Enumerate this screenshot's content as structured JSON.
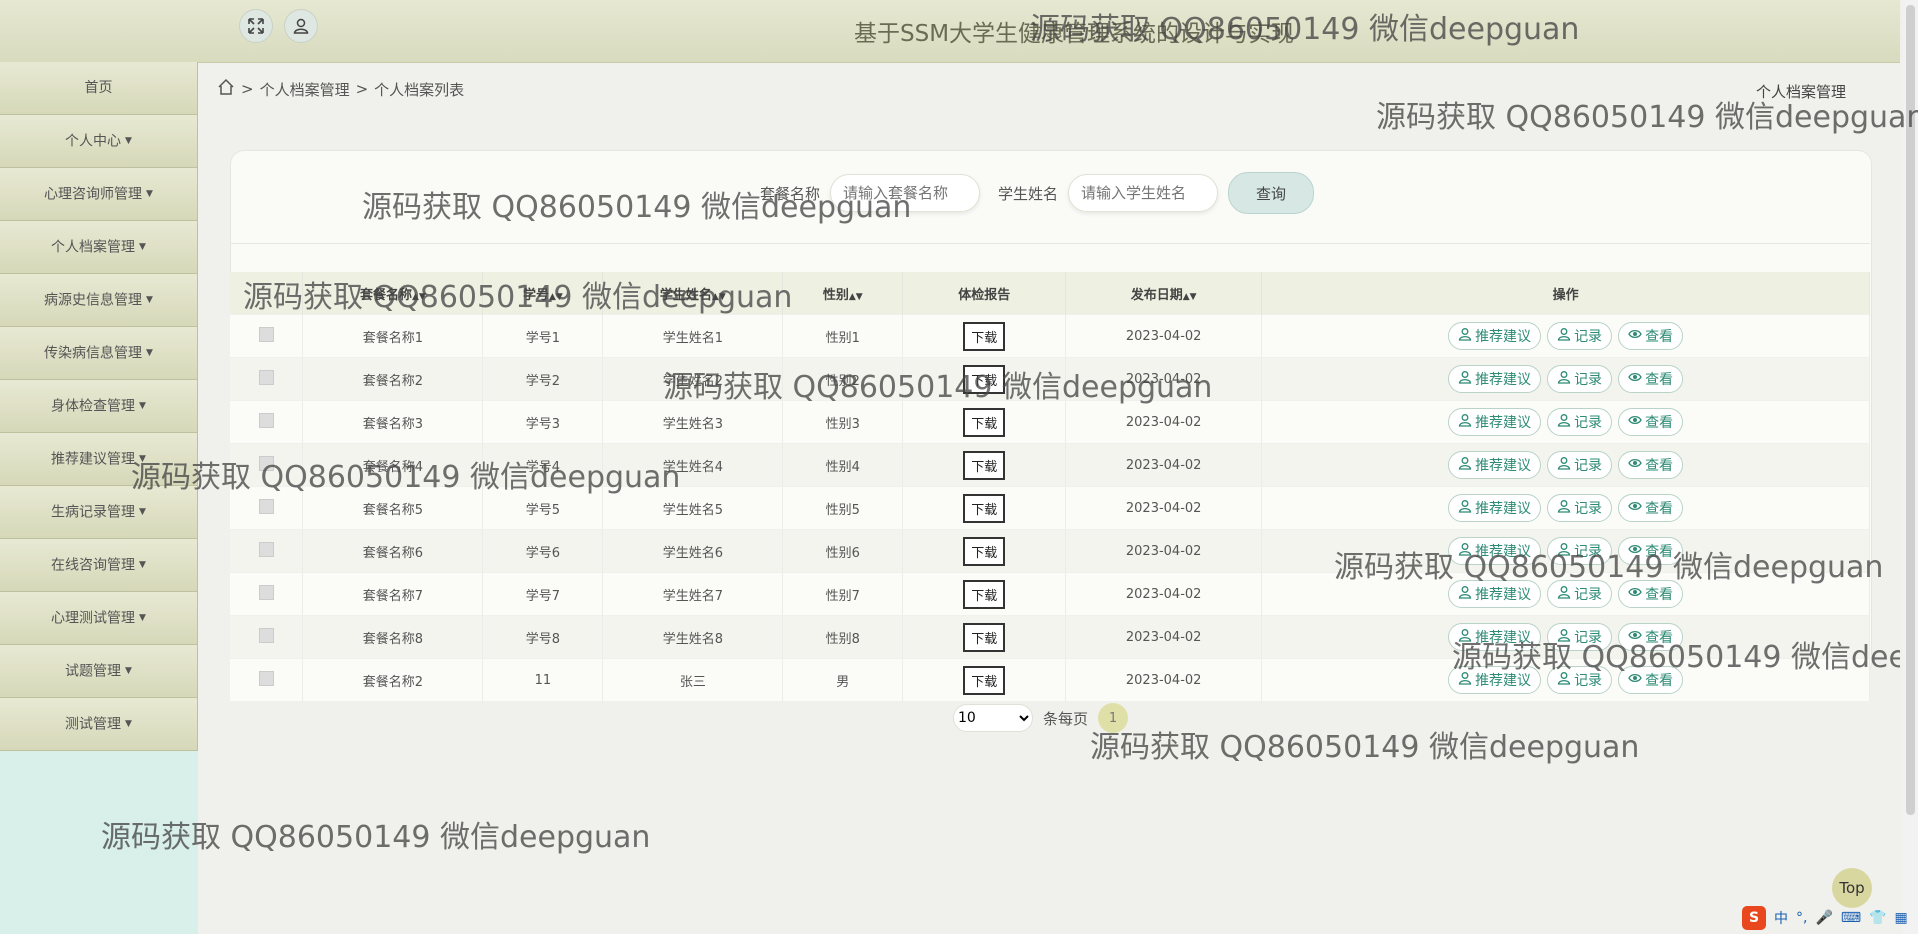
{
  "header": {
    "title": "基于SSM大学生健康管理系统的设计与实现"
  },
  "sidebar": {
    "items": [
      {
        "label": "首页",
        "caret": false
      },
      {
        "label": "个人中心",
        "caret": true
      },
      {
        "label": "心理咨询师管理",
        "caret": true
      },
      {
        "label": "个人档案管理",
        "caret": true
      },
      {
        "label": "病源史信息管理",
        "caret": true
      },
      {
        "label": "传染病信息管理",
        "caret": true
      },
      {
        "label": "身体检查管理",
        "caret": true
      },
      {
        "label": "推荐建议管理",
        "caret": true
      },
      {
        "label": "生病记录管理",
        "caret": true
      },
      {
        "label": "在线咨询管理",
        "caret": true
      },
      {
        "label": "心理测试管理",
        "caret": true
      },
      {
        "label": "试题管理",
        "caret": true
      },
      {
        "label": "测试管理",
        "caret": true
      }
    ]
  },
  "breadcrumb": {
    "sep": ">",
    "level1": "个人档案管理",
    "level2": "个人档案列表"
  },
  "page_label": "个人档案管理",
  "search": {
    "field1_label": "套餐名称",
    "field1_placeholder": "请输入套餐名称",
    "field2_label": "学生姓名",
    "field2_placeholder": "请输入学生姓名",
    "button": "查询"
  },
  "table": {
    "headers": [
      "套餐名称",
      "学号",
      "学生姓名",
      "性别",
      "体检报告",
      "发布日期",
      "操作"
    ],
    "download_label": "下载",
    "actions": [
      "推荐建议",
      "记录",
      "查看"
    ],
    "rows": [
      [
        "套餐名称1",
        "学号1",
        "学生姓名1",
        "性别1",
        "2023-04-02"
      ],
      [
        "套餐名称2",
        "学号2",
        "学生姓名2",
        "性别2",
        "2023-04-02"
      ],
      [
        "套餐名称3",
        "学号3",
        "学生姓名3",
        "性别3",
        "2023-04-02"
      ],
      [
        "套餐名称4",
        "学号4",
        "学生姓名4",
        "性别4",
        "2023-04-02"
      ],
      [
        "套餐名称5",
        "学号5",
        "学生姓名5",
        "性别5",
        "2023-04-02"
      ],
      [
        "套餐名称6",
        "学号6",
        "学生姓名6",
        "性别6",
        "2023-04-02"
      ],
      [
        "套餐名称7",
        "学号7",
        "学生姓名7",
        "性别7",
        "2023-04-02"
      ],
      [
        "套餐名称8",
        "学号8",
        "学生姓名8",
        "性别8",
        "2023-04-02"
      ],
      [
        "套餐名称2",
        "11",
        "张三",
        "男",
        "2023-04-02"
      ]
    ]
  },
  "pagination": {
    "page_size": "10",
    "per_page_label": "条每页",
    "current_page": "1"
  },
  "top_button": "Top",
  "watermark_text": "源码获取 QQ86050149 微信deepguan",
  "ime": {
    "lang": "中",
    "punct": "°,"
  },
  "colors": {
    "accent": "#2e8b76",
    "sidebar_bg": "#d9efe9",
    "menu_bg": "#e0e1c6"
  }
}
